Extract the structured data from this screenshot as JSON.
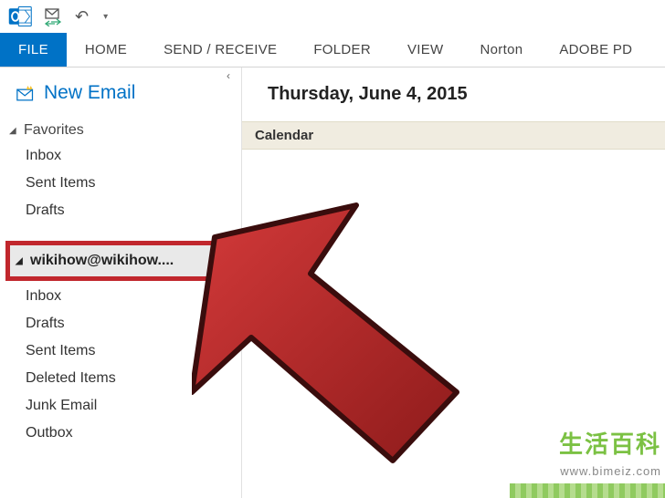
{
  "qat": {
    "undo_tooltip": "Undo"
  },
  "ribbon": {
    "tabs": [
      "FILE",
      "HOME",
      "SEND / RECEIVE",
      "FOLDER",
      "VIEW",
      "Norton",
      "ADOBE PD"
    ],
    "active_index": 0
  },
  "nav": {
    "new_email_label": "New Email",
    "favorites_label": "Favorites",
    "favorites": [
      "Inbox",
      "Sent Items",
      "Drafts"
    ],
    "account_label": "wikihow@wikihow....",
    "account_folders": [
      "Inbox",
      "Drafts",
      "Sent Items",
      "Deleted Items",
      "Junk Email",
      "Outbox"
    ]
  },
  "content": {
    "date_header": "Thursday, June 4, 2015",
    "calendar_label": "Calendar"
  },
  "watermark": {
    "text": "生活百科",
    "url": "www.bimeiz.com"
  }
}
